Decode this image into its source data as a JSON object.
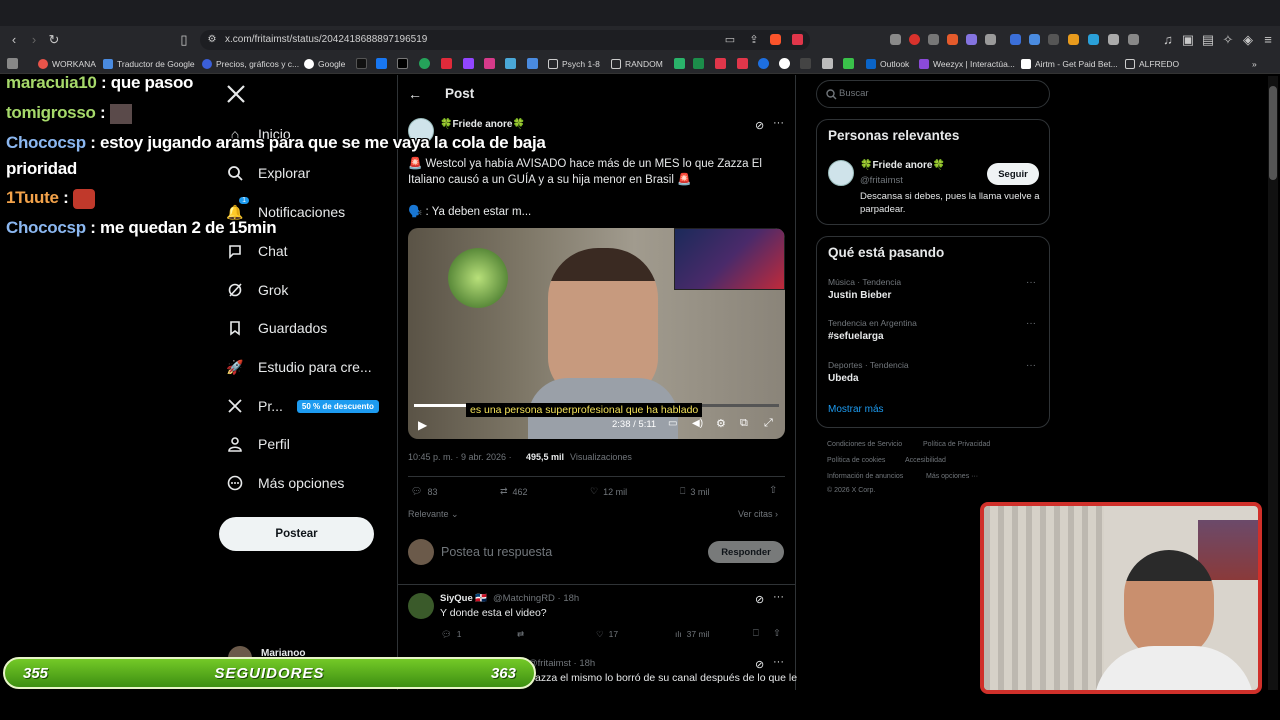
{
  "browser": {
    "url": "x.com/fritaimst/status/2042418688897196519",
    "bookmarks": [
      "WORKANA",
      "Traductor de Google",
      "Precios, gráficos y c...",
      "Google",
      "Psych 1-8",
      "RANDOM",
      "Outlook",
      "Weezyx | Interactúa...",
      "Airtm - Get Paid Bet...",
      "ALFREDO"
    ]
  },
  "chat": [
    {
      "user": "maracuia10",
      "msg": ": que pasoo"
    },
    {
      "user": "tomigrosso",
      "msg": ":"
    },
    {
      "user": "Chococsp",
      "msg": ": estoy jugando arams para que se me vaya la cola de baja"
    },
    {
      "user": "",
      "msg": "prioridad"
    },
    {
      "user": "1Tuute",
      "msg": ":"
    },
    {
      "user": "Chococsp",
      "msg": ": me quedan 2 de 15min"
    }
  ],
  "nav": {
    "items": [
      "Inicio",
      "Explorar",
      "Notificaciones",
      "Chat",
      "Grok",
      "Guardados",
      "Estudio para cre...",
      "Pr...",
      "Perfil",
      "Más opciones"
    ],
    "notif_count": "1",
    "premium_badge": "50 % de descuento",
    "post_button": "Postear",
    "account_name": "Marianoo"
  },
  "post": {
    "header": "Post",
    "author_name": "🍀Friede anore🍀",
    "body_line1": "🚨 Westcol ya había AVISADO hace más de un MES lo que Zazza El",
    "body_line2": "Italiano causó a un GUÍA y a su hija menor en Brasil 🚨",
    "body_line3": "🗣️ : Ya deben estar m...",
    "video_caption": "es una persona superprofesional que ha hablado",
    "video_time": "2:38 / 5:11",
    "timestamp": "10:45 p. m. · 9 abr. 2026 ·",
    "views_count": "495,5 mil",
    "views_label": "Visualizaciones",
    "replies": "83",
    "reposts": "462",
    "likes": "12 mil",
    "bookmarks": "3 mil",
    "sort_label": "Relevante",
    "quotes_link": "Ver citas",
    "reply_placeholder": "Postea tu respuesta",
    "reply_button": "Responder"
  },
  "replies": [
    {
      "name": "SiyQue 🇩🇴",
      "handle": "@MatchingRD · 18h",
      "text": "Y donde esta el video?",
      "replies": "1",
      "likes": "17",
      "views": "37 mil"
    },
    {
      "handle": "@fritaimst · 18h",
      "text": "azza el mismo lo borró de su canal después de lo que le"
    }
  ],
  "sidebar": {
    "search_placeholder": "Buscar",
    "relevant_title": "Personas relevantes",
    "person_name": "🍀Friede anore🍀",
    "person_handle": "@fritaimst",
    "follow_label": "Seguir",
    "person_bio": "Descansa si debes, pues la llama vuelve a parpadear.",
    "trending_title": "Qué está pasando",
    "trends": [
      {
        "context": "Música · Tendencia",
        "topic": "Justin Bieber"
      },
      {
        "context": "Tendencia en Argentina",
        "topic": "#sefuelarga"
      },
      {
        "context": "Deportes · Tendencia",
        "topic": "Ubeda"
      }
    ],
    "show_more": "Mostrar más",
    "footer_links": [
      "Condiciones de Servicio",
      "Política de Privacidad",
      "Política de cookies",
      "Accesibilidad",
      "Información de anuncios",
      "Más opciones ···"
    ],
    "copyright": "© 2026 X Corp."
  },
  "followers": {
    "left": "355",
    "label": "SEGUIDORES",
    "right": "363"
  }
}
